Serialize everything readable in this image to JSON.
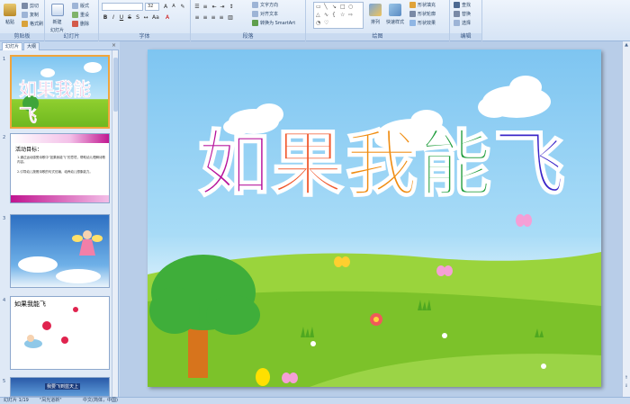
{
  "ribbon": {
    "clipboard": {
      "paste": "粘贴",
      "cut": "剪切",
      "copy": "复制",
      "format_painter": "格式刷",
      "label": "剪贴板"
    },
    "slides": {
      "new_slide": "新建",
      "new_slide_2": "幻灯片",
      "layout": "版式",
      "reset": "重设",
      "delete": "删除",
      "label": "幻灯片"
    },
    "font": {
      "font_name": "",
      "font_size": "32",
      "label": "字体"
    },
    "paragraph": {
      "text_direction": "文字方向",
      "align_text": "对齐文本",
      "convert_smartart": "转换为 SmartArt",
      "label": "段落"
    },
    "drawing": {
      "arrange": "排列",
      "quick_styles": "快速样式",
      "shape_fill": "形状填充",
      "shape_outline": "形状轮廓",
      "shape_effects": "形状效果",
      "label": "绘图"
    },
    "editing": {
      "find": "查找",
      "replace": "替换",
      "select": "选择",
      "label": "编辑"
    }
  },
  "panel": {
    "tabs": [
      "幻灯片",
      "大纲"
    ],
    "close": "×",
    "slide_numbers": [
      "1",
      "2",
      "3",
      "4",
      "5"
    ],
    "thumb1_title": "如果我能飞",
    "thumb2_heading": "活动目标：",
    "thumb2_bullets": [
      "1.通过运动感受诗歌中“如果我能飞”的意境，帮助幼儿理解诗歌内容。",
      "2.引导幼儿按照诗歌的句式仿编，培养幼儿想象能力。"
    ],
    "thumb4_title": "如果我能飞",
    "thumb5_caption": "我要飞到蓝天上"
  },
  "slide": {
    "title_chars": [
      "如",
      "果",
      "我",
      "能",
      "飞"
    ],
    "title_colors": [
      "#b5109b",
      "#f0562a",
      "#f08c10",
      "#1f9d3c",
      "#3a25c8"
    ]
  },
  "status": {
    "slide_info": "幻灯片 1/19",
    "theme": "\"凤光道新\"",
    "language": "中文(简体，中国)"
  },
  "colors": {
    "ribbon_bg": "#dfe9f6",
    "accent_selected": "#f0a53c",
    "sky": "#7ec5f1",
    "grass": "#8fcf2f"
  }
}
